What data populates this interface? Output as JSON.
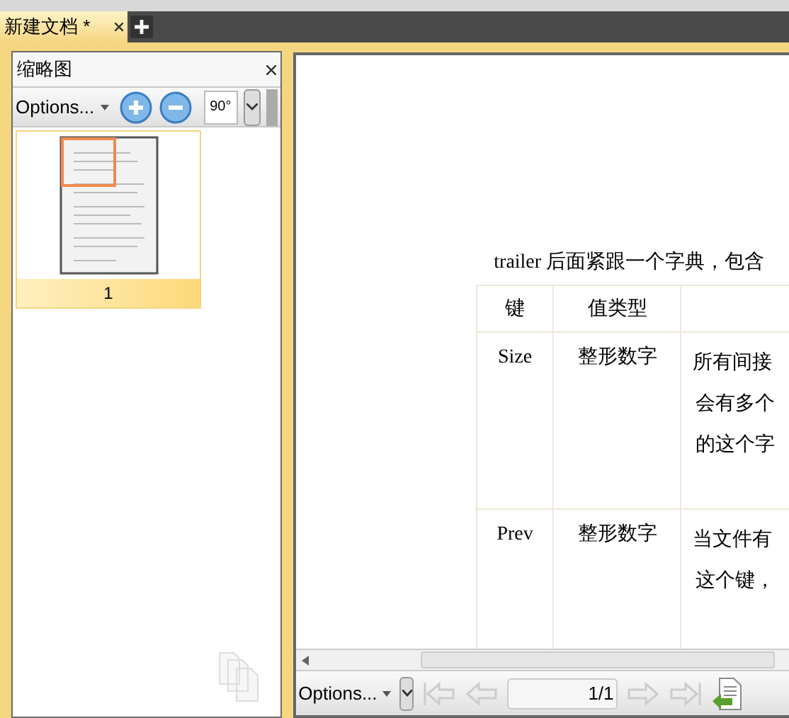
{
  "tabs": [
    {
      "label": "新建文档 *",
      "selected": true
    }
  ],
  "thumbnail_panel": {
    "title": "缩略图",
    "options": "Options...",
    "rotate": "90°",
    "thumbnails": [
      {
        "label": "1",
        "selected": true
      }
    ]
  },
  "document": {
    "intro": "trailer 后面紧跟一个字典，包含",
    "table": {
      "columns": [
        "键",
        "值类型",
        ""
      ],
      "rows": [
        {
          "key": "Size",
          "type": "整形数字",
          "description": [
            "所有间接",
            "会有多个",
            "的这个字"
          ]
        },
        {
          "key": "Prev",
          "type": "整形数字",
          "description": [
            "当文件有",
            "这个键，"
          ]
        }
      ]
    }
  },
  "bottom_toolbar": {
    "options": "Options...",
    "page": "1/1"
  }
}
